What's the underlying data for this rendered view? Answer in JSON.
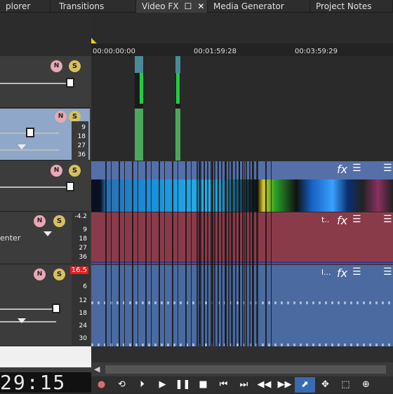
{
  "tabs": [
    {
      "label": "plorer"
    },
    {
      "label": "Transitions"
    },
    {
      "label": "Video FX",
      "active": true
    },
    {
      "label": "Media Generator"
    },
    {
      "label": "Project Notes"
    }
  ],
  "ruler": {
    "t0": "00:00:00:00",
    "t1": "00:01:59:28",
    "t2": "00:03:59:29"
  },
  "track_headers": {
    "mute_label": "N",
    "solo_label": "S",
    "meter_labels_a": [
      "9",
      "18",
      "27",
      "36"
    ],
    "meter_labels_c": [
      "-4.2",
      "9",
      "18",
      "27",
      "36"
    ],
    "meter_labels_d": [
      "16.5",
      "6",
      "12",
      "18",
      "24",
      "30"
    ],
    "audio_label": "enter",
    "clip_label_t": "t..",
    "clip_label_l": "l...",
    "fx_label": "fx"
  },
  "timecode": "29:15",
  "colors": {
    "video_track": "#5570a8",
    "audio_red": "#8a3b4a",
    "audio_blue": "#4a6aa0",
    "selected_header": "#8fa7c8"
  }
}
